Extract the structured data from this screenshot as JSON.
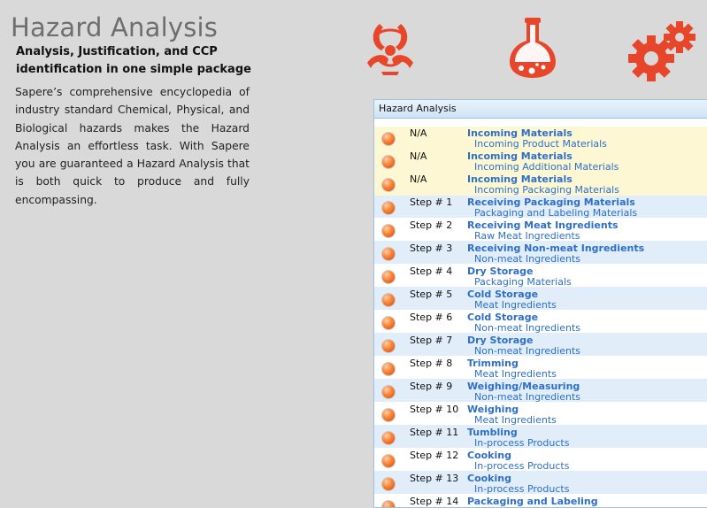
{
  "page": {
    "title": "Hazard Analysis",
    "subtitle": "Analysis, Justification, and CCP identification in one simple package",
    "intro": "Sapere’s comprehensive encyclopedia of industry standard Chemical, Physical, and Biological hazards makes the Hazard Analysis an effortless task. With Sapere you are guaranteed a Hazard Analysis that is both quick to produce and fully encompassing."
  },
  "icons": {
    "accent_color": "#e8462a",
    "items": [
      "biohazard-icon",
      "flask-icon",
      "gears-icon"
    ]
  },
  "panel": {
    "header": "Hazard Analysis",
    "rows": [
      {
        "step": "N/A",
        "title": "Incoming Materials",
        "sub": "Incoming Product Materials",
        "kind": "na"
      },
      {
        "step": "N/A",
        "title": "Incoming Materials",
        "sub": "Incoming Additional Materials",
        "kind": "na"
      },
      {
        "step": "N/A",
        "title": "Incoming Materials",
        "sub": "Incoming Packaging Materials",
        "kind": "na"
      },
      {
        "step": "Step # 1",
        "title": "Receiving Packaging Materials",
        "sub": "Packaging and Labeling Materials",
        "kind": "step"
      },
      {
        "step": "Step # 2",
        "title": "Receiving Meat Ingredients",
        "sub": "Raw Meat Ingredients",
        "kind": "step"
      },
      {
        "step": "Step # 3",
        "title": "Receiving Non-meat Ingredients",
        "sub": "Non-meat Ingredients",
        "kind": "step"
      },
      {
        "step": "Step # 4",
        "title": "Dry Storage",
        "sub": "Packaging Materials",
        "kind": "step"
      },
      {
        "step": "Step # 5",
        "title": "Cold Storage",
        "sub": "Meat Ingredients",
        "kind": "step"
      },
      {
        "step": "Step # 6",
        "title": "Cold Storage",
        "sub": "Non-meat Ingredients",
        "kind": "step"
      },
      {
        "step": "Step # 7",
        "title": "Dry Storage",
        "sub": "Non-meat Ingredients",
        "kind": "step"
      },
      {
        "step": "Step # 8",
        "title": "Trimming",
        "sub": "Meat Ingredients",
        "kind": "step"
      },
      {
        "step": "Step # 9",
        "title": "Weighing/Measuring",
        "sub": "Non-meat Ingredients",
        "kind": "step"
      },
      {
        "step": "Step # 10",
        "title": "Weighing",
        "sub": "Meat Ingredients",
        "kind": "step"
      },
      {
        "step": "Step # 11",
        "title": "Tumbling",
        "sub": "In-process Products",
        "kind": "step"
      },
      {
        "step": "Step # 12",
        "title": "Cooking",
        "sub": "In-process Products",
        "kind": "step"
      },
      {
        "step": "Step # 13",
        "title": "Cooking",
        "sub": "In-process Products",
        "kind": "step"
      },
      {
        "step": "Step # 14",
        "title": "Packaging and Labeling",
        "sub": "",
        "kind": "step"
      }
    ]
  }
}
